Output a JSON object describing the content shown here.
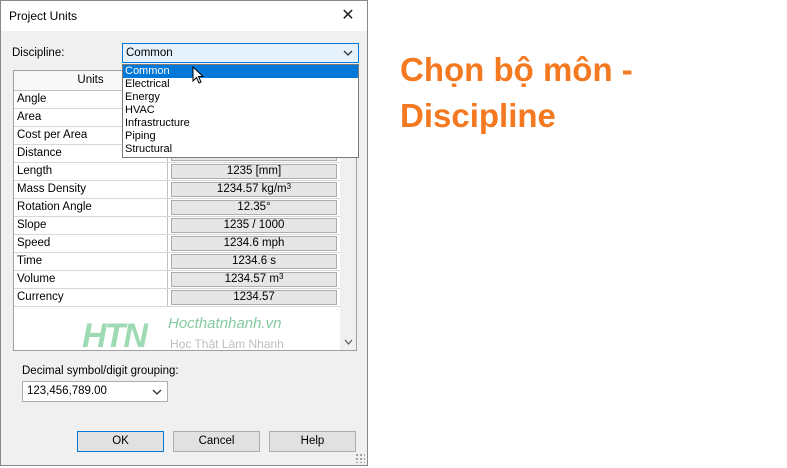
{
  "dialog": {
    "title": "Project Units",
    "close_glyph": "✕",
    "discipline_label": "Discipline:",
    "discipline_value": "Common",
    "discipline_options": [
      "Common",
      "Electrical",
      "Energy",
      "HVAC",
      "Infrastructure",
      "Piping",
      "Structural"
    ],
    "table": {
      "header_units": "Units",
      "rows": [
        {
          "name": "Angle",
          "format": ""
        },
        {
          "name": "Area",
          "format": ""
        },
        {
          "name": "Cost per Area",
          "format": ""
        },
        {
          "name": "Distance",
          "format": ""
        },
        {
          "name": "Length",
          "format": "1235 [mm]"
        },
        {
          "name": "Mass Density",
          "format": "1234.57 kg/m",
          "sup": "3"
        },
        {
          "name": "Rotation Angle",
          "format": "12.35°"
        },
        {
          "name": "Slope",
          "format": "1235 / 1000"
        },
        {
          "name": "Speed",
          "format": "1234.6 mph"
        },
        {
          "name": "Time",
          "format": "1234.6 s"
        },
        {
          "name": "Volume",
          "format": "1234.57 m",
          "sup": "3"
        },
        {
          "name": "Currency",
          "format": "1234.57"
        }
      ]
    },
    "watermark": {
      "mark": "HTN",
      "site": "Hocthatnhanh.vn",
      "slogan": "Học Thật  Làm Nhanh"
    },
    "grouping_label": "Decimal symbol/digit grouping:",
    "grouping_value": "123,456,789.00",
    "buttons": {
      "ok": "OK",
      "cancel": "Cancel",
      "help": "Help"
    }
  },
  "caption": "Chọn bộ môn - Discipline",
  "colors": {
    "accent": "#0078d7",
    "caption": "#f47920",
    "selection_bg": "#e5f1fb"
  }
}
